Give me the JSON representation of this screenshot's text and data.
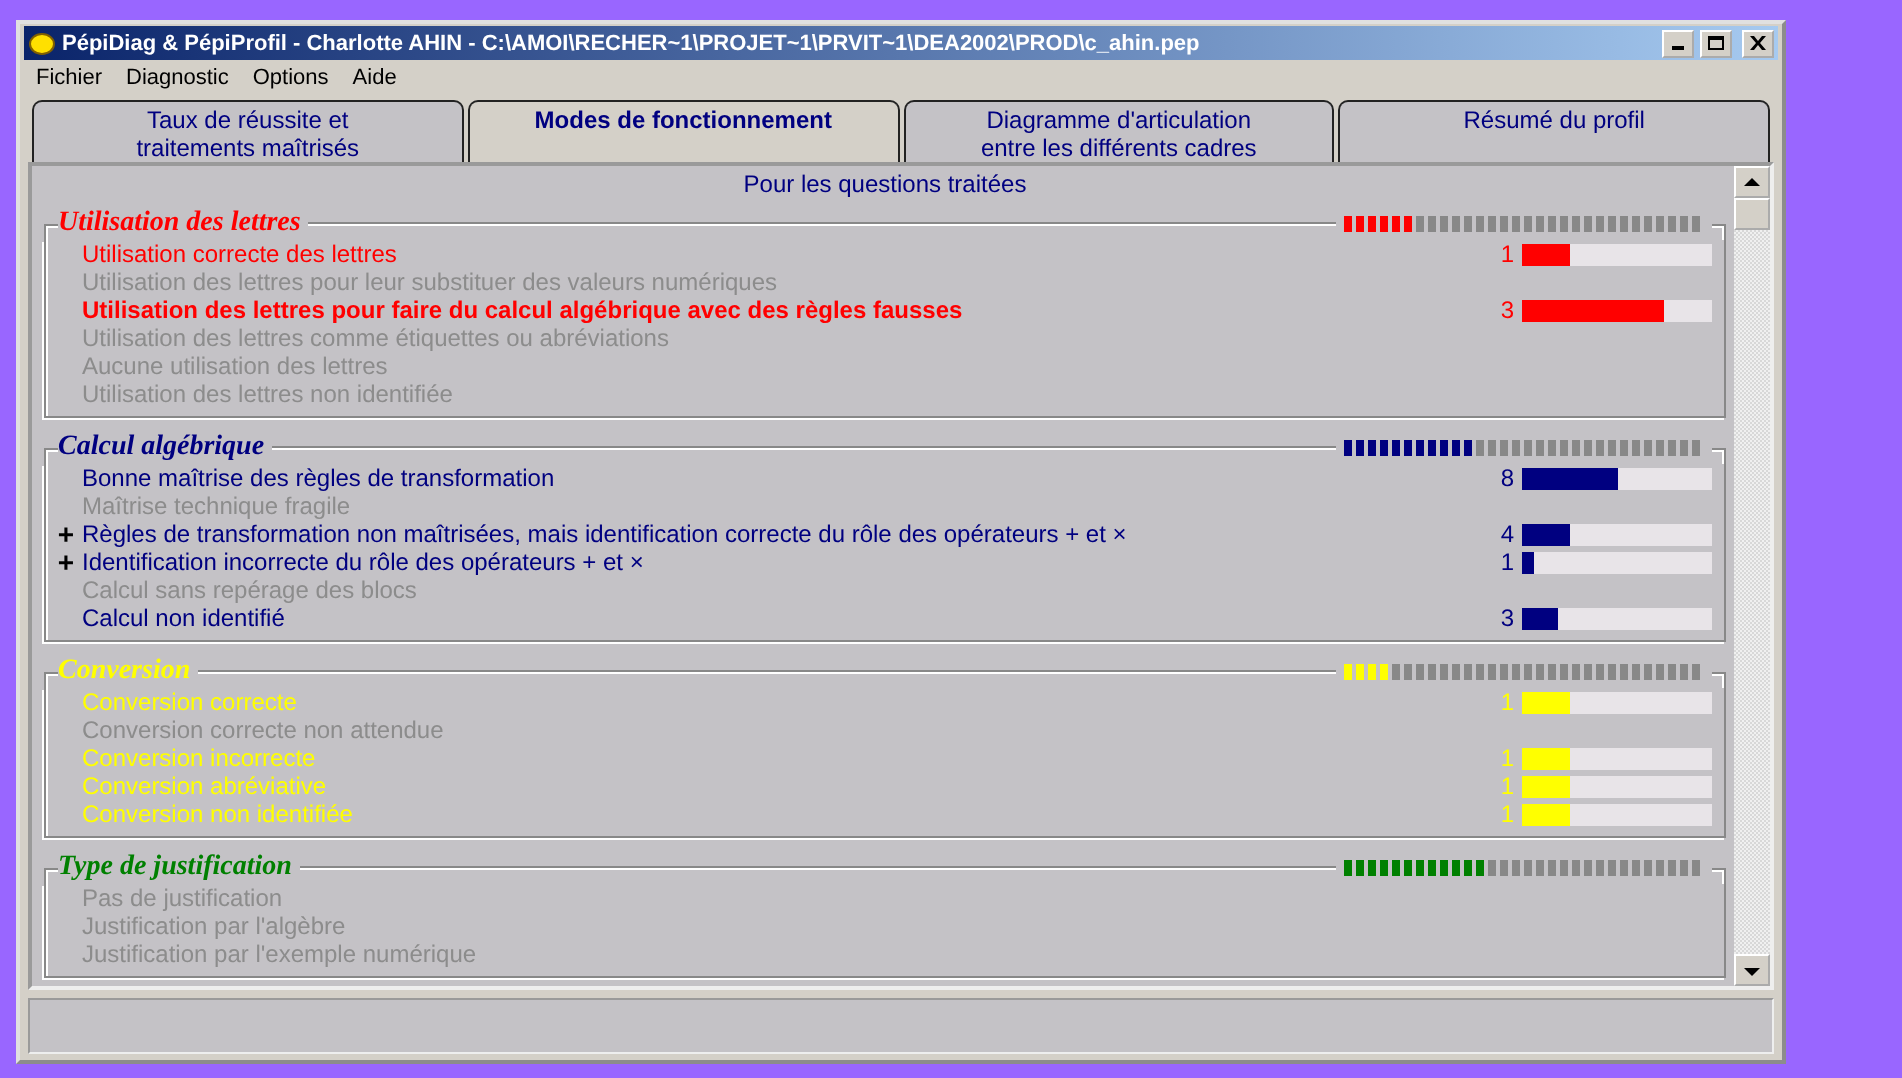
{
  "window": {
    "title": "PépiDiag & PépiProfil - Charlotte AHIN - C:\\AMOI\\RECHER~1\\PROJET~1\\PRVIT~1\\DEA2002\\PROD\\c_ahin.pep"
  },
  "menu": [
    "Fichier",
    "Diagnostic",
    "Options",
    "Aide"
  ],
  "tabs": [
    {
      "lines": [
        "Taux de réussite et",
        "traitements maîtrisés"
      ],
      "selected": false
    },
    {
      "lines": [
        "Modes de fonctionnement"
      ],
      "selected": true
    },
    {
      "lines": [
        "Diagramme d'articulation",
        "entre les différents cadres"
      ],
      "selected": false
    },
    {
      "lines": [
        "Résumé du profil"
      ],
      "selected": false
    }
  ],
  "heading": "Pour les questions traitées",
  "sections": [
    {
      "title": "Utilisation des lettres",
      "color": "#ff0000",
      "level": 0.21,
      "items": [
        {
          "text": "Utilisation correcte des lettres",
          "active": true,
          "bold": false,
          "count": "1",
          "level": 0.25
        },
        {
          "text": "Utilisation des lettres pour leur substituer des valeurs numériques",
          "active": false,
          "bold": false
        },
        {
          "text": "Utilisation des lettres pour faire du calcul algébrique avec des règles fausses",
          "active": true,
          "bold": true,
          "count": "3",
          "level": 0.75
        },
        {
          "text": "Utilisation des lettres comme étiquettes ou abréviations",
          "active": false,
          "bold": false
        },
        {
          "text": "Aucune utilisation des lettres",
          "active": false,
          "bold": false
        },
        {
          "text": "Utilisation des lettres non identifiée",
          "active": false,
          "bold": false
        }
      ]
    },
    {
      "title": "Calcul algébrique",
      "color": "#000080",
      "level": 0.38,
      "items": [
        {
          "text": "Bonne maîtrise des règles de transformation",
          "active": true,
          "bold": false,
          "count": "8",
          "level": 0.51
        },
        {
          "text": "Maîtrise technique fragile",
          "active": false,
          "bold": false
        },
        {
          "marker": "+",
          "text": "Règles de transformation non maîtrisées, mais identification correcte du rôle des opérateurs + et ×",
          "active": true,
          "bold": false,
          "count": "4",
          "level": 0.25
        },
        {
          "marker": "+",
          "text": "Identification incorrecte du rôle des opérateurs + et ×",
          "active": true,
          "bold": false,
          "count": "1",
          "level": 0.06
        },
        {
          "text": "Calcul sans repérage des blocs",
          "active": false,
          "bold": false
        },
        {
          "text": "Calcul non identifié",
          "active": true,
          "bold": false,
          "count": "3",
          "level": 0.19
        }
      ]
    },
    {
      "title": "Conversion",
      "color": "#ffff00",
      "level": 0.13,
      "items": [
        {
          "text": "Conversion correcte",
          "active": true,
          "bold": false,
          "count": "1",
          "level": 0.25
        },
        {
          "text": "Conversion correcte non attendue",
          "active": false,
          "bold": false
        },
        {
          "text": "Conversion incorrecte",
          "active": true,
          "bold": false,
          "count": "1",
          "level": 0.25
        },
        {
          "text": "Conversion abréviative",
          "active": true,
          "bold": false,
          "count": "1",
          "level": 0.25
        },
        {
          "text": "Conversion non identifiée",
          "active": true,
          "bold": false,
          "count": "1",
          "level": 0.25
        }
      ]
    },
    {
      "title": "Type de justification",
      "color": "#008000",
      "level": 0.41,
      "items": [
        {
          "text": "Pas de justification",
          "active": false,
          "bold": false
        },
        {
          "text": "Justification par l'algèbre",
          "active": false,
          "bold": false
        },
        {
          "text": "Justification par l'exemple numérique",
          "active": false,
          "bold": false
        }
      ]
    }
  ]
}
